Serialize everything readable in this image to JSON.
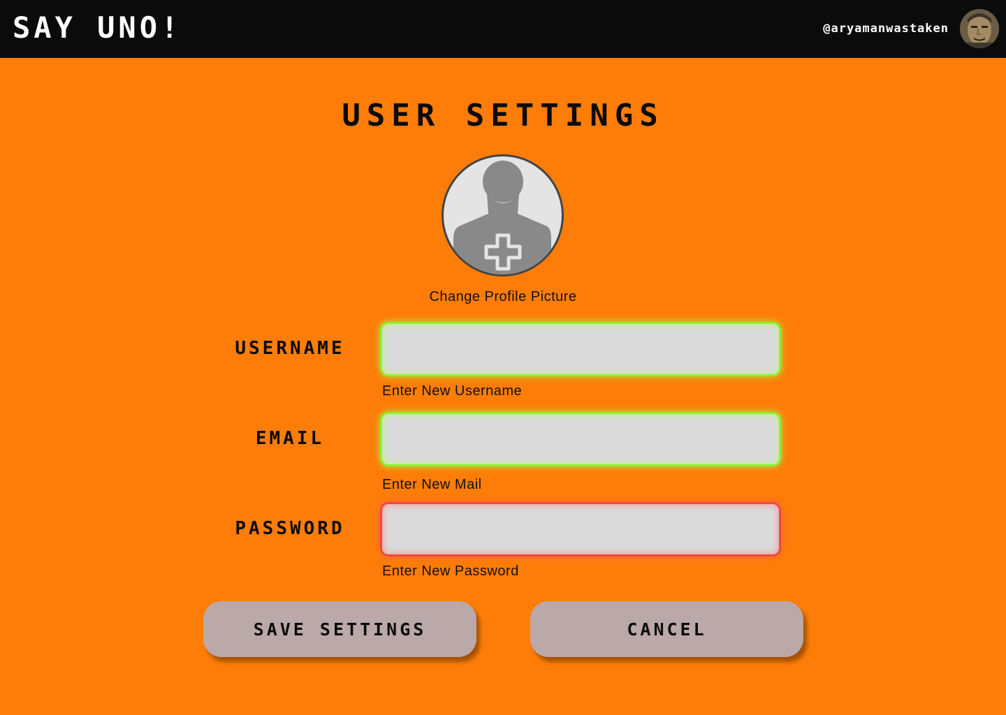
{
  "header": {
    "app_title": "SAY UNO!",
    "user_handle": "@aryamanwastaken",
    "avatar_icon": "user-avatar-photo"
  },
  "page": {
    "title": "USER SETTINGS"
  },
  "profile": {
    "icon": "add-user-icon",
    "caption": "Change Profile Picture"
  },
  "fields": {
    "username": {
      "label": "USERNAME",
      "value": "",
      "hint": "Enter New Username",
      "status": "valid"
    },
    "email": {
      "label": "EMAIL",
      "value": "",
      "hint": "Enter New Mail",
      "status": "valid"
    },
    "password": {
      "label": "PASSWORD",
      "value": "",
      "hint": "Enter New Password",
      "status": "invalid"
    }
  },
  "actions": {
    "save_label": "SAVE SETTINGS",
    "cancel_label": "CANCEL"
  },
  "colors": {
    "background": "#fd7d08",
    "topbar": "#0b0b0b",
    "button": "#bba8a8",
    "valid_glow": "#8ef02c",
    "invalid_glow": "#f0483e",
    "input_fill": "#dadada"
  }
}
